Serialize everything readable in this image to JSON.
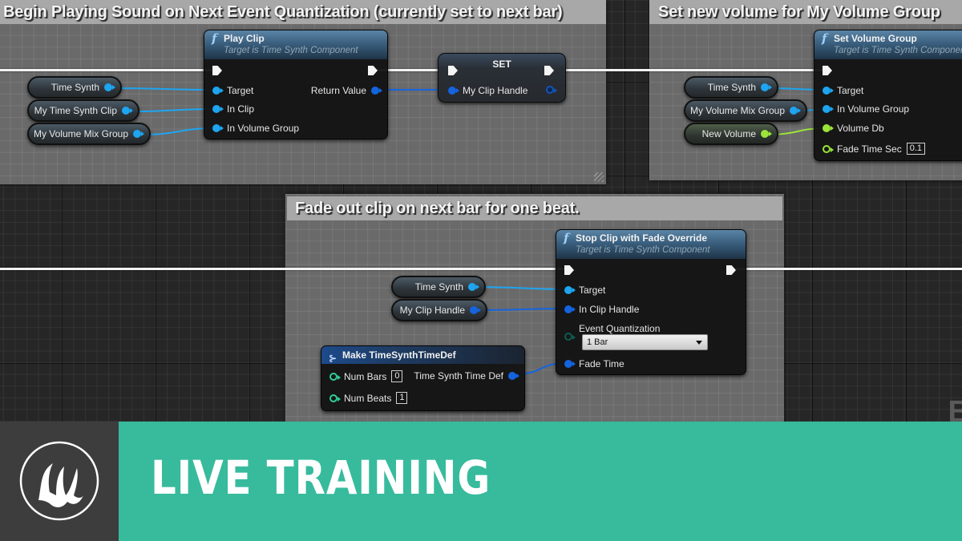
{
  "comments": {
    "top_left": {
      "title": "Begin Playing Sound on Next Event Quantization (currently set to next bar)"
    },
    "top_right": {
      "title": "Set new volume for My Volume Group"
    },
    "bottom": {
      "title": "Fade out clip on next bar for one beat."
    }
  },
  "play_clip": {
    "title": "Play Clip",
    "subtitle": "Target is Time Synth Component",
    "inputs": [
      "Target",
      "In Clip",
      "In Volume Group"
    ],
    "output": "Return Value",
    "vars": [
      "Time Synth",
      "My Time Synth Clip",
      "My Volume Mix Group"
    ]
  },
  "set_node": {
    "title": "SET",
    "input": "My Clip Handle"
  },
  "set_volume_group": {
    "title": "Set Volume Group",
    "subtitle": "Target is Time Synth Component",
    "inputs": [
      "Target",
      "In Volume Group",
      "Volume Db",
      "Fade Time Sec"
    ],
    "fade_time_value": "0.1",
    "vars": [
      "Time Synth",
      "My Volume Mix Group",
      "New Volume"
    ]
  },
  "stop_clip": {
    "title": "Stop Clip with Fade Override",
    "subtitle": "Target is Time Synth Component",
    "inputs": [
      "Target",
      "In Clip Handle",
      "Event Quantization",
      "Fade Time"
    ],
    "quantization_selected": "1 Bar",
    "vars": [
      "Time Synth",
      "My Clip Handle"
    ]
  },
  "make_time_def": {
    "title": "Make TimeSynthTimeDef",
    "inputs": [
      {
        "label": "Num Bars",
        "value": "0"
      },
      {
        "label": "Num Beats",
        "value": "1"
      }
    ],
    "output": "Time Synth Time Def"
  },
  "ghost_text": "B",
  "banner": {
    "text": "LIVE TRAINING",
    "accent": "#37bb9c",
    "logo_bg": "#3d3d3d"
  },
  "colors": {
    "object_pin": "#1ea5f0",
    "struct_pin": "#1464e0",
    "float_pin": "#9be53a",
    "int_pin": "#2fcf98"
  }
}
